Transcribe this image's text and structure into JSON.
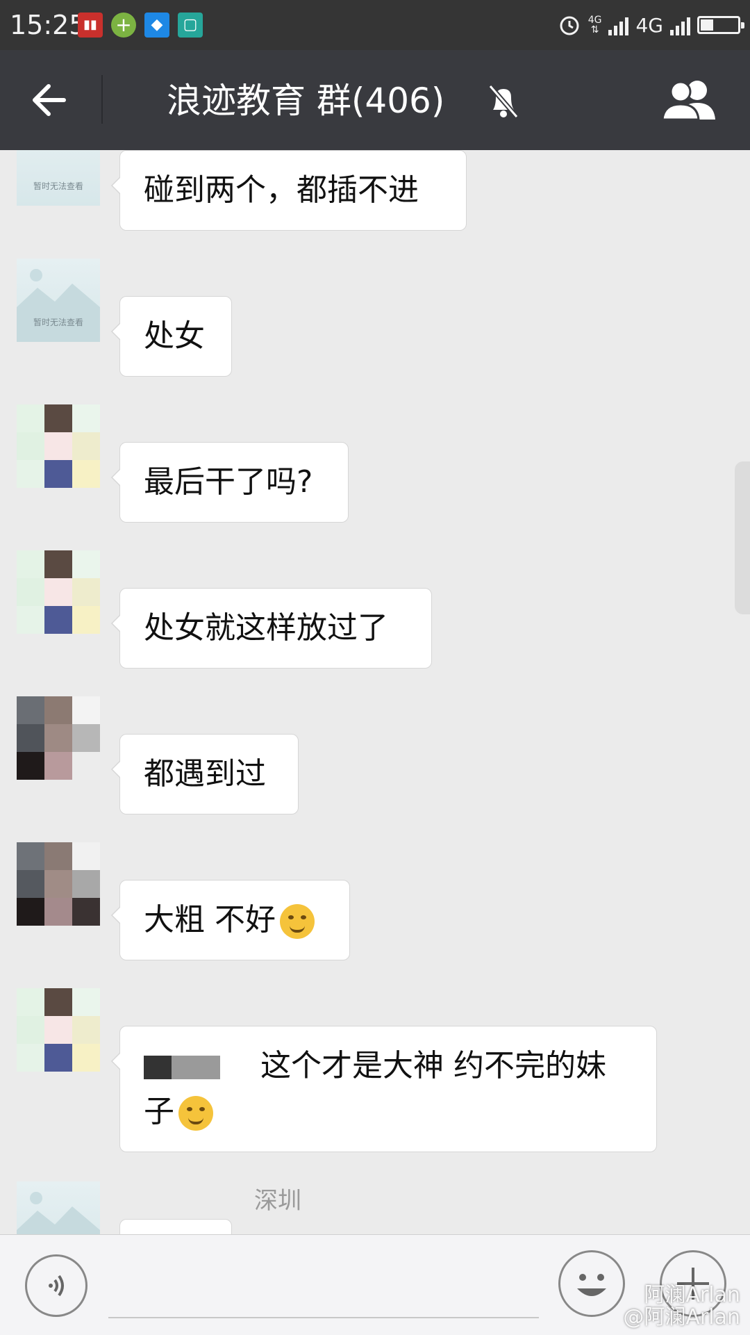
{
  "status_bar": {
    "time": "15:25",
    "network_small": "4G",
    "network": "4G",
    "notification_icons": [
      "listen-app-icon",
      "plus-app-icon",
      "alipay-icon",
      "scan-icon"
    ],
    "battery_level": 0.35
  },
  "header": {
    "title": "浪迹教育 群(406)",
    "back_icon": "arrow-left-icon",
    "mute_icon": "bell-muted-icon",
    "members_icon": "group-members-icon"
  },
  "placeholder_avatar_text": "暂时无法查看",
  "messages": [
    {
      "text": "碰到两个，都插不进"
    },
    {
      "text": "处女"
    },
    {
      "text": "最后干了吗?"
    },
    {
      "text": "处女就这样放过了"
    },
    {
      "text": "都遇到过"
    },
    {
      "text": "大粗 不好"
    },
    {
      "text_line1": "这个才是大神 约不完的妹",
      "text_line2": "子"
    },
    {
      "sender": "深圳"
    }
  ],
  "input_bar": {
    "voice_icon": "voice-icon",
    "emoji_icon": "smiley-icon",
    "plus_icon": "plus-icon"
  },
  "watermark": {
    "line1": "阿澜Arlan",
    "line2": "@阿澜Arlan"
  },
  "colors": {
    "header_bg": "#393a3f",
    "status_bg": "#353535",
    "chat_bg": "#ebebeb",
    "bubble_bg": "#ffffff"
  }
}
